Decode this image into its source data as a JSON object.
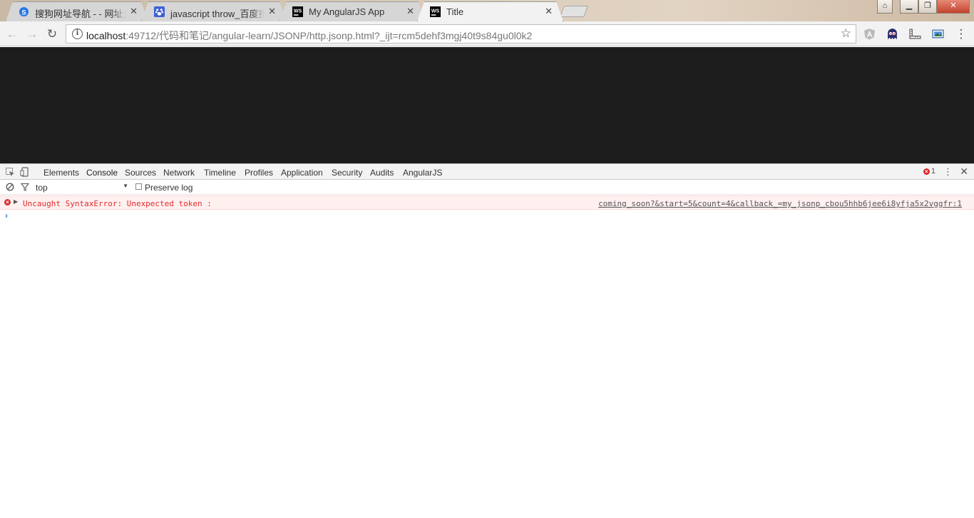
{
  "tabs": [
    {
      "title": "搜狗网址导航 - - 网址大全",
      "icon": "sogou-icon",
      "close": "✕"
    },
    {
      "title": "javascript throw_百度搜索",
      "icon": "baidu-paw-icon",
      "close": "✕"
    },
    {
      "title": "My AngularJS App",
      "icon": "webstorm-icon",
      "close": "✕"
    },
    {
      "title": "Title",
      "icon": "webstorm-icon",
      "close": "✕",
      "active": true
    }
  ],
  "window_controls": {
    "user": "⌂",
    "minimize": "▁",
    "maximize": "❐",
    "close": "✕"
  },
  "toolbar": {
    "back": "←",
    "forward": "→",
    "reload": "↻",
    "info": "i",
    "url_host": "localhost",
    "url_rest": ":49712/代码和笔记/angular-learn/JSONP/http.jsonp.html?_ijt=rcm5dehf3mgj40t9s84gu0l0k2",
    "bookmark": "☆",
    "menu": "⋮",
    "extensions": [
      "angular-extension-icon",
      "ghost-extension-icon",
      "ruler-extension-icon",
      "screenshot-extension-icon"
    ]
  },
  "devtools": {
    "tabs": [
      "Elements",
      "Console",
      "Sources",
      "Network",
      "Timeline",
      "Profiles",
      "Application",
      "Security",
      "Audits",
      "AngularJS"
    ],
    "active_tab": "Console",
    "error_count": "1",
    "more": "⋮",
    "close": "✕",
    "console": {
      "context": "top",
      "preserve_log": "Preserve log",
      "messages": [
        {
          "level": "error",
          "text": "Uncaught SyntaxError: Unexpected token :",
          "source": "coming_soon?&start=5&count=4&callback_=my_jsonp_cbou5hhb6jee6i8yfja5x2vggfr:1"
        }
      ],
      "prompt": "›"
    }
  },
  "colors": {
    "viewport_bg": "#1d1d1d",
    "error_text": "#e42a2a",
    "error_row_bg": "#fff0f0"
  }
}
